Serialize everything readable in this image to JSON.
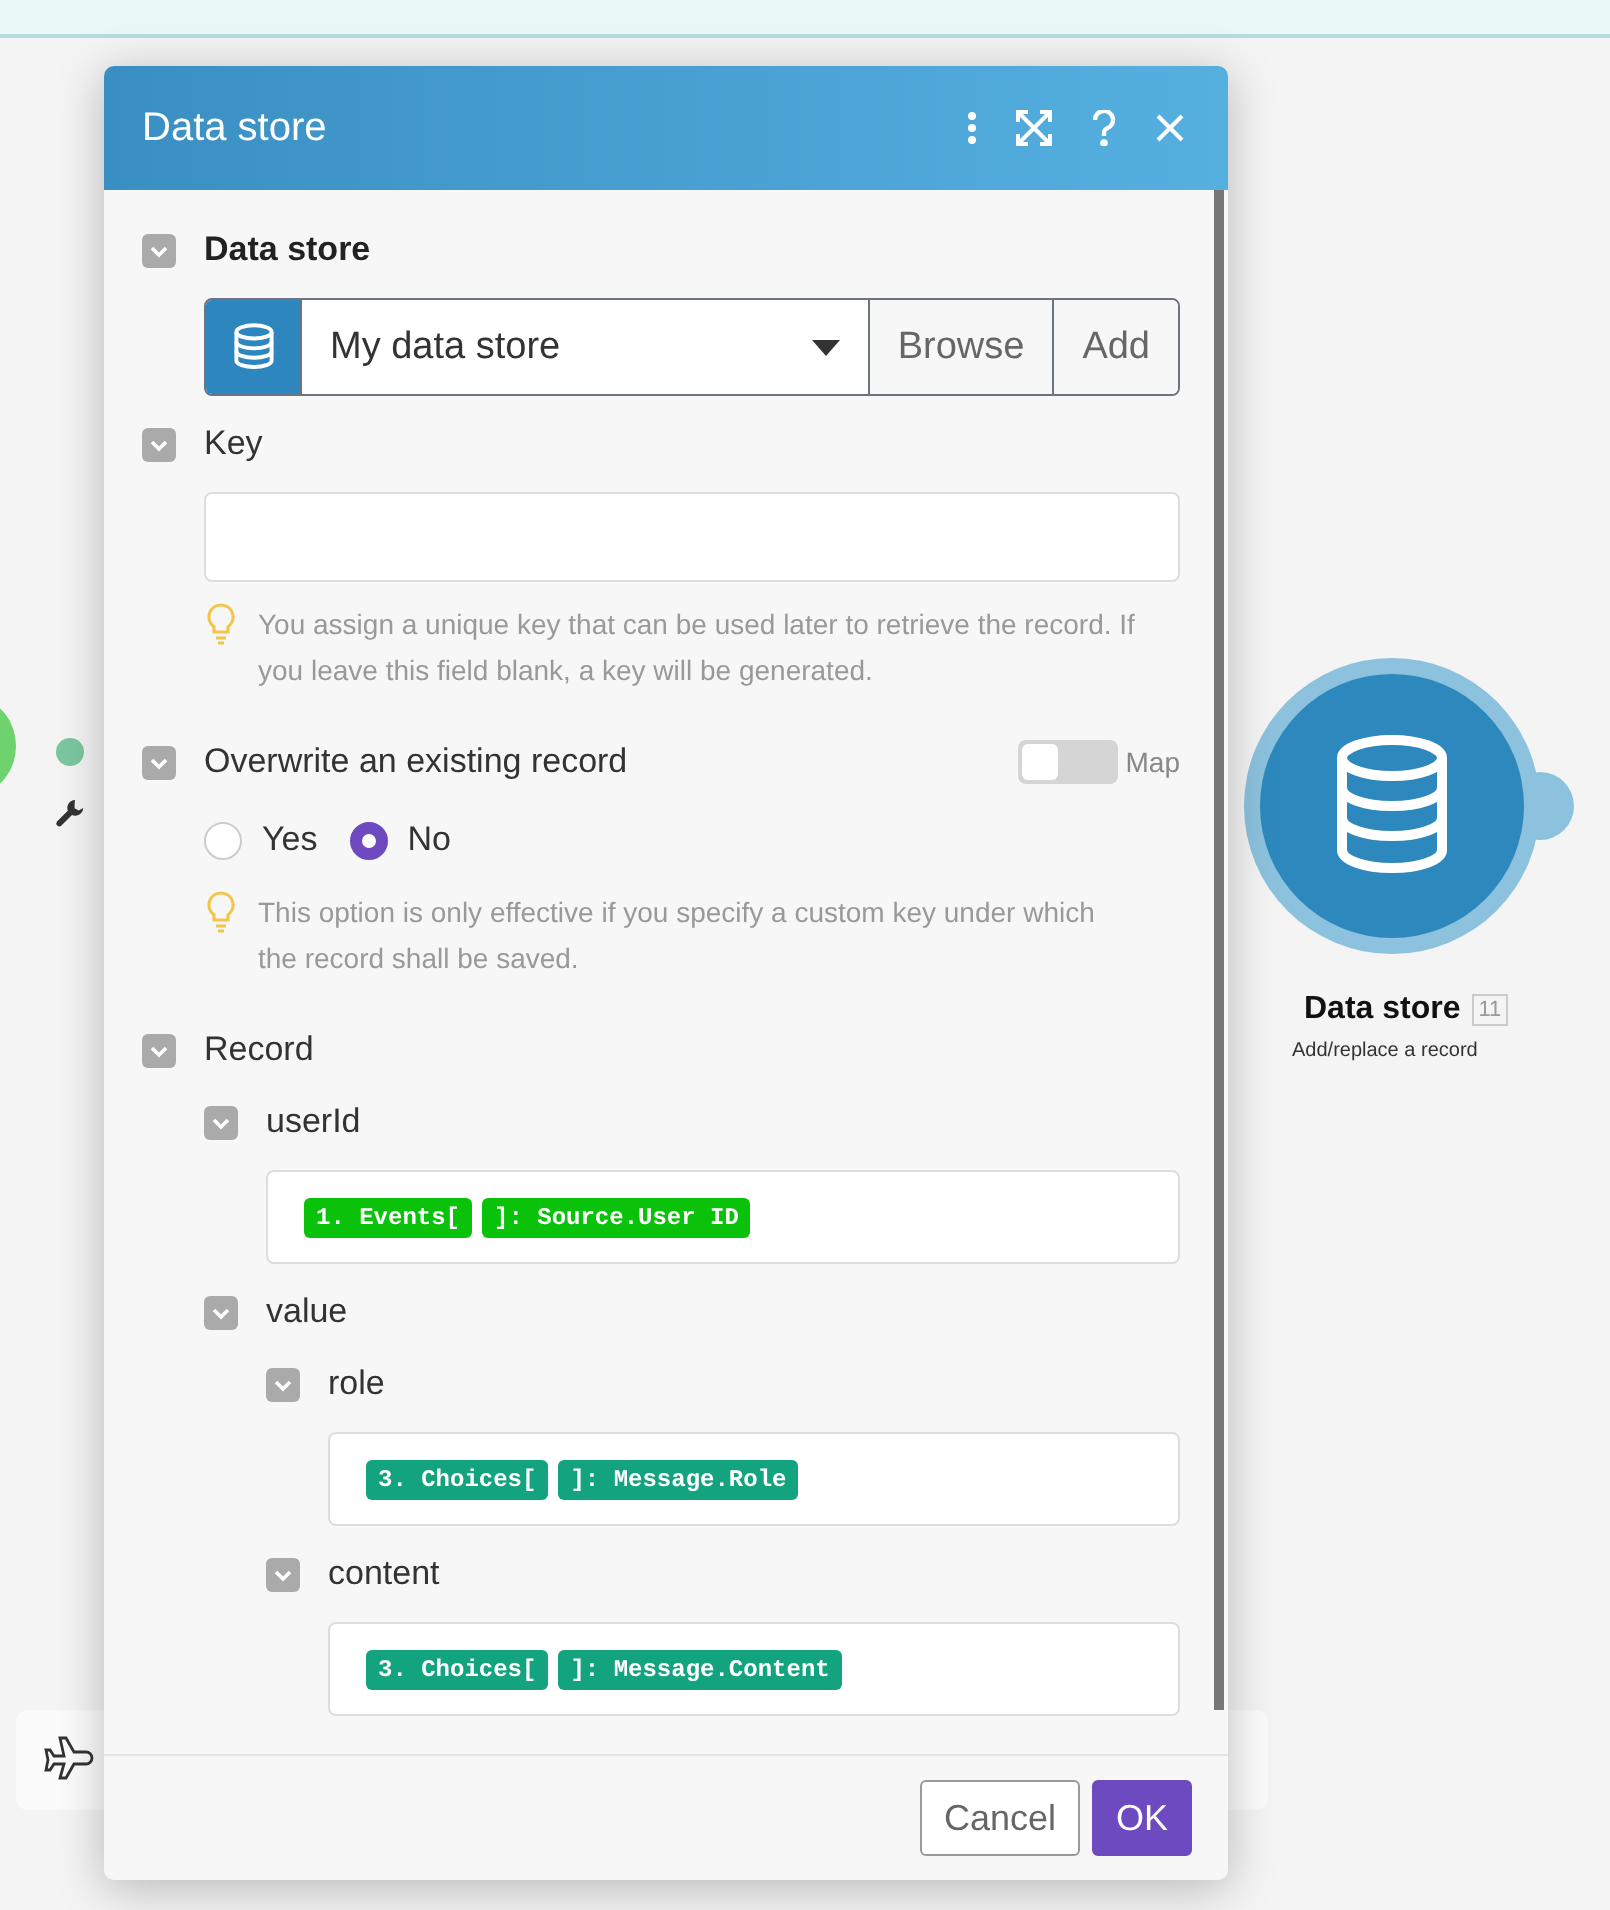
{
  "dialog": {
    "title": "Data store",
    "fields": [
      {
        "kind": "select",
        "label": "Data store",
        "required": true,
        "expanded": true,
        "value": "My data store",
        "buttons": [
          "Browse",
          "Add"
        ]
      },
      {
        "kind": "text",
        "label": "Key",
        "required": false,
        "expanded": true,
        "hint": "You assign a unique key that can be used later to retrieve the record. If you leave this field blank, a key will be generated."
      },
      {
        "kind": "radio",
        "label": "Overwrite an existing record",
        "required": false,
        "expanded": true,
        "map": {
          "label": "Map",
          "on": false
        },
        "options": [
          {
            "label": "Yes",
            "selected": false
          },
          {
            "label": "No",
            "selected": true
          }
        ],
        "hint": "This option is only effective if you specify a custom key under which the record shall be saved."
      },
      {
        "kind": "group",
        "label": "Record",
        "required": false,
        "expanded": true,
        "children": [
          {
            "kind": "tokens",
            "label": "userId",
            "required": false,
            "expanded": true,
            "tokens": [
              {
                "text": "1. Events[",
                "color": "#0ac20a"
              },
              {
                "text": "]: Source.User ID",
                "color": "#0ac20a"
              }
            ]
          },
          {
            "kind": "group",
            "label": "value",
            "required": false,
            "expanded": true,
            "children": [
              {
                "kind": "tokens",
                "label": "role",
                "required": false,
                "expanded": true,
                "tokens": [
                  {
                    "text": "3. Choices[",
                    "color": "#14a37f"
                  },
                  {
                    "text": "]: Message.Role",
                    "color": "#14a37f"
                  }
                ]
              },
              {
                "kind": "tokens",
                "label": "content",
                "required": false,
                "expanded": true,
                "tokens": [
                  {
                    "text": "3. Choices[",
                    "color": "#14a37f"
                  },
                  {
                    "text": "]: Message.Content",
                    "color": "#14a37f"
                  }
                ]
              }
            ]
          }
        ]
      }
    ],
    "buttons": [
      {
        "label": "Cancel",
        "kind": "secondary"
      },
      {
        "label": "OK",
        "kind": "primary"
      }
    ]
  },
  "node": {
    "title": "Data store",
    "badge": "11",
    "subtitle": "Add/replace a record"
  }
}
